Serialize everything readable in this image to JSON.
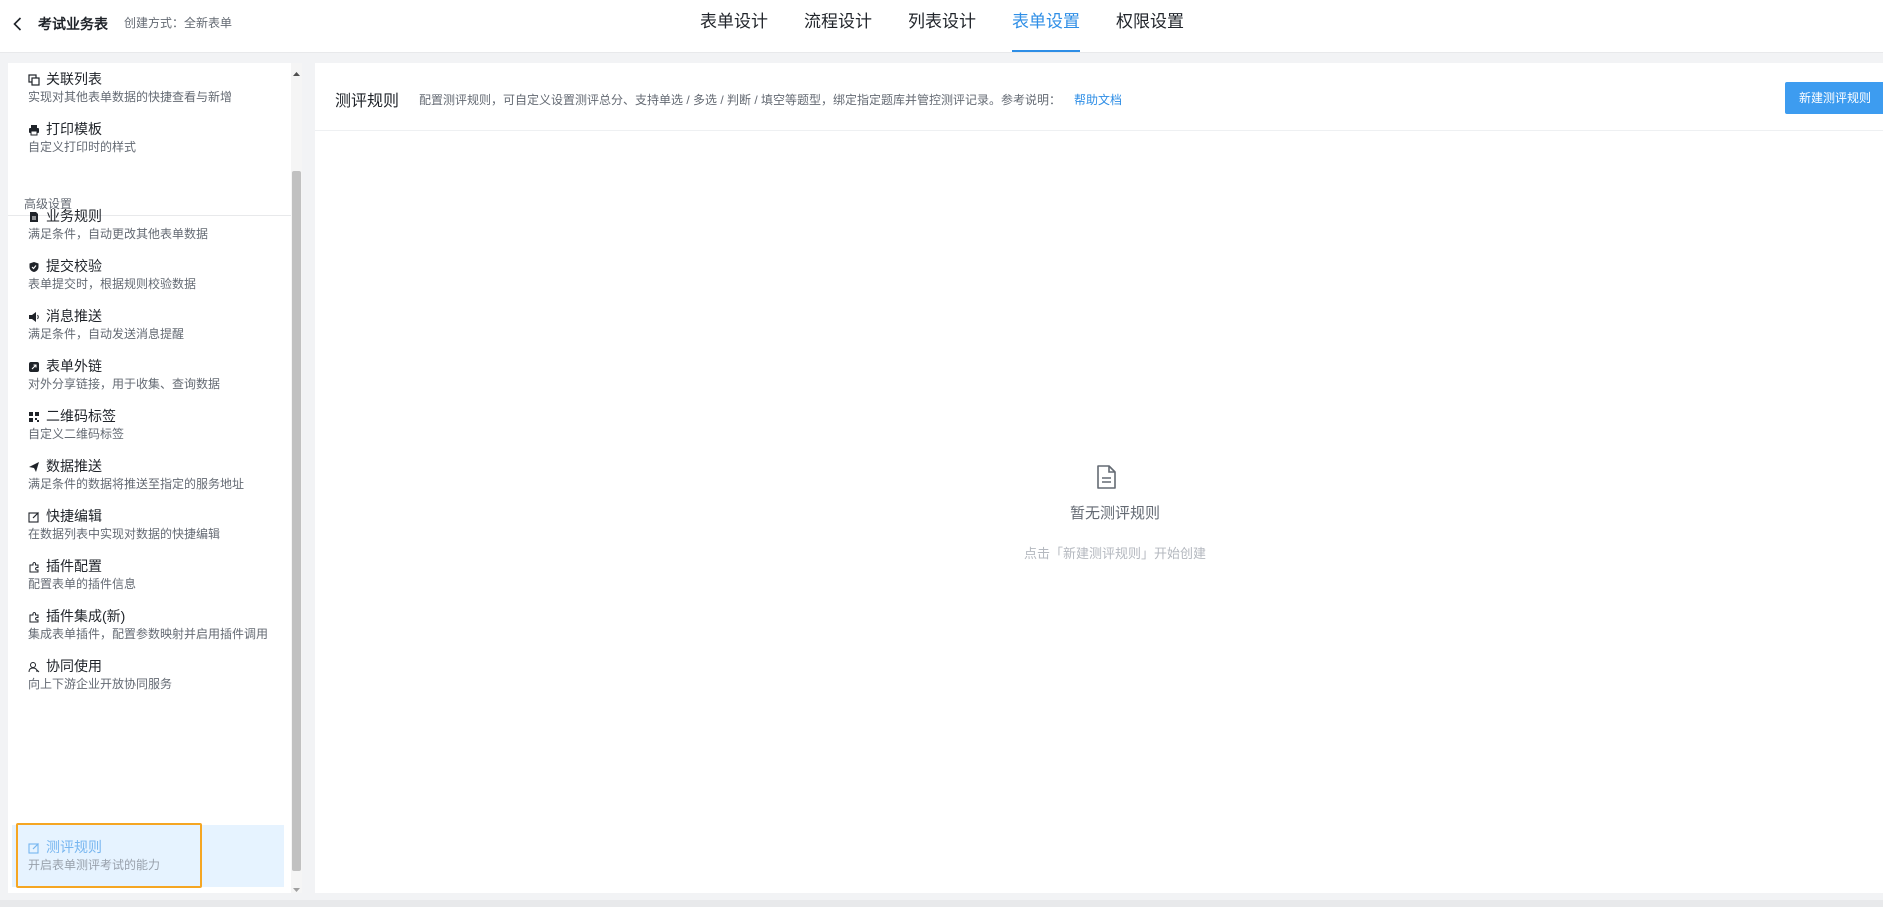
{
  "header": {
    "title": "考试业务表",
    "create_mode": "创建方式：全新表单",
    "tabs": [
      {
        "label": "表单设计",
        "active": false
      },
      {
        "label": "流程设计",
        "active": false
      },
      {
        "label": "列表设计",
        "active": false
      },
      {
        "label": "表单设置",
        "active": true
      },
      {
        "label": "权限设置",
        "active": false
      }
    ]
  },
  "sidebar": {
    "items": [
      {
        "icon": "linked-list-icon",
        "title": "关联列表",
        "desc": "实现对其他表单数据的快捷查看与新增"
      },
      {
        "icon": "printer-icon",
        "title": "打印模板",
        "desc": "自定义打印时的样式"
      }
    ],
    "section": "高级设置",
    "advanced_items": [
      {
        "icon": "document-icon",
        "title": "业务规则",
        "desc": "满足条件，自动更改其他表单数据"
      },
      {
        "icon": "shield-icon",
        "title": "提交校验",
        "desc": "表单提交时，根据规则校验数据"
      },
      {
        "icon": "speaker-icon",
        "title": "消息推送",
        "desc": "满足条件，自动发送消息提醒"
      },
      {
        "icon": "external-link-icon",
        "title": "表单外链",
        "desc": "对外分享链接，用于收集、查询数据"
      },
      {
        "icon": "qrcode-icon",
        "title": "二维码标签",
        "desc": "自定义二维码标签"
      },
      {
        "icon": "send-icon",
        "title": "数据推送",
        "desc": "满足条件的数据将推送至指定的服务地址"
      },
      {
        "icon": "edit-icon",
        "title": "快捷编辑",
        "desc": "在数据列表中实现对数据的快捷编辑"
      },
      {
        "icon": "plugin-icon",
        "title": "插件配置",
        "desc": "配置表单的插件信息"
      },
      {
        "icon": "plugin-icon",
        "title": "插件集成(新)",
        "desc": "集成表单插件，配置参数映射并启用插件调用"
      },
      {
        "icon": "collaboration-icon",
        "title": "协同使用",
        "desc": "向上下游企业开放协同服务"
      },
      {
        "icon": "edit-icon",
        "title": "测评规则",
        "desc": "开启表单测评考试的能力"
      }
    ]
  },
  "main": {
    "title": "测评规则",
    "desc": "配置测评规则，可自定义设置测评总分、支持单选 / 多选 / 判断 / 填空等题型，绑定指定题库并管控测评记录。参考说明：",
    "help_link": "帮助文档",
    "new_button": "新建测评规则",
    "empty_title": "暂无测评规则",
    "empty_hint": "点击「新建测评规则」开始创建"
  },
  "colors": {
    "accent": "#2e8ee6",
    "button": "#3d9cf0",
    "highlight_border": "#f5a623",
    "selected_bg": "#e6f3ff"
  }
}
